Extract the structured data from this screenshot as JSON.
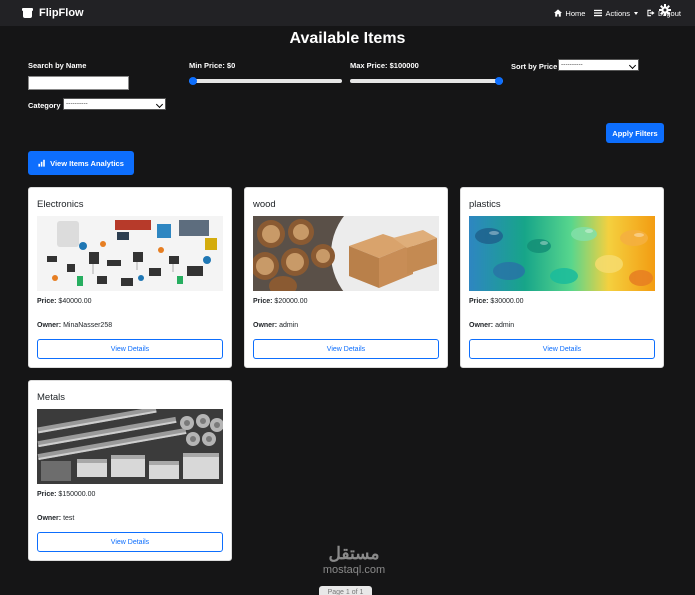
{
  "navbar": {
    "brand": "FlipFlow",
    "home_label": "Home",
    "actions_label": "Actions",
    "logout_label": "Logout"
  },
  "page_title": "Available Items",
  "filters": {
    "search_label": "Search by Name",
    "search_value": "",
    "min_price_label": "Min Price: $0",
    "min_price_value": 0,
    "max_price_label": "Max Price: $100000",
    "max_price_value": 100000,
    "sort_label": "Sort by Price",
    "sort_selected": "----------",
    "category_label": "Category",
    "category_selected": "----------",
    "apply_label": "Apply Filters"
  },
  "analytics_button": "View Items Analytics",
  "items": [
    {
      "title": "Electronics",
      "price_label": "Price:",
      "price": "$40000.00",
      "owner_label": "Owner:",
      "owner": "MinaNasser258",
      "button": "View Details"
    },
    {
      "title": "wood",
      "price_label": "Price:",
      "price": "$20000.00",
      "owner_label": "Owner:",
      "owner": "admin",
      "button": "View Details"
    },
    {
      "title": "plastics",
      "price_label": "Price:",
      "price": "$30000.00",
      "owner_label": "Owner:",
      "owner": "admin",
      "button": "View Details"
    },
    {
      "title": "Metals",
      "price_label": "Price:",
      "price": "$150000.00",
      "owner_label": "Owner:",
      "owner": "test",
      "button": "View Details"
    }
  ],
  "watermark": {
    "arabic": "مستقل",
    "latin": "mostaql.com"
  },
  "pagination": "Page 1 of 1",
  "colors": {
    "primary": "#0d6efd",
    "background": "#151516",
    "navbar": "#222225"
  }
}
